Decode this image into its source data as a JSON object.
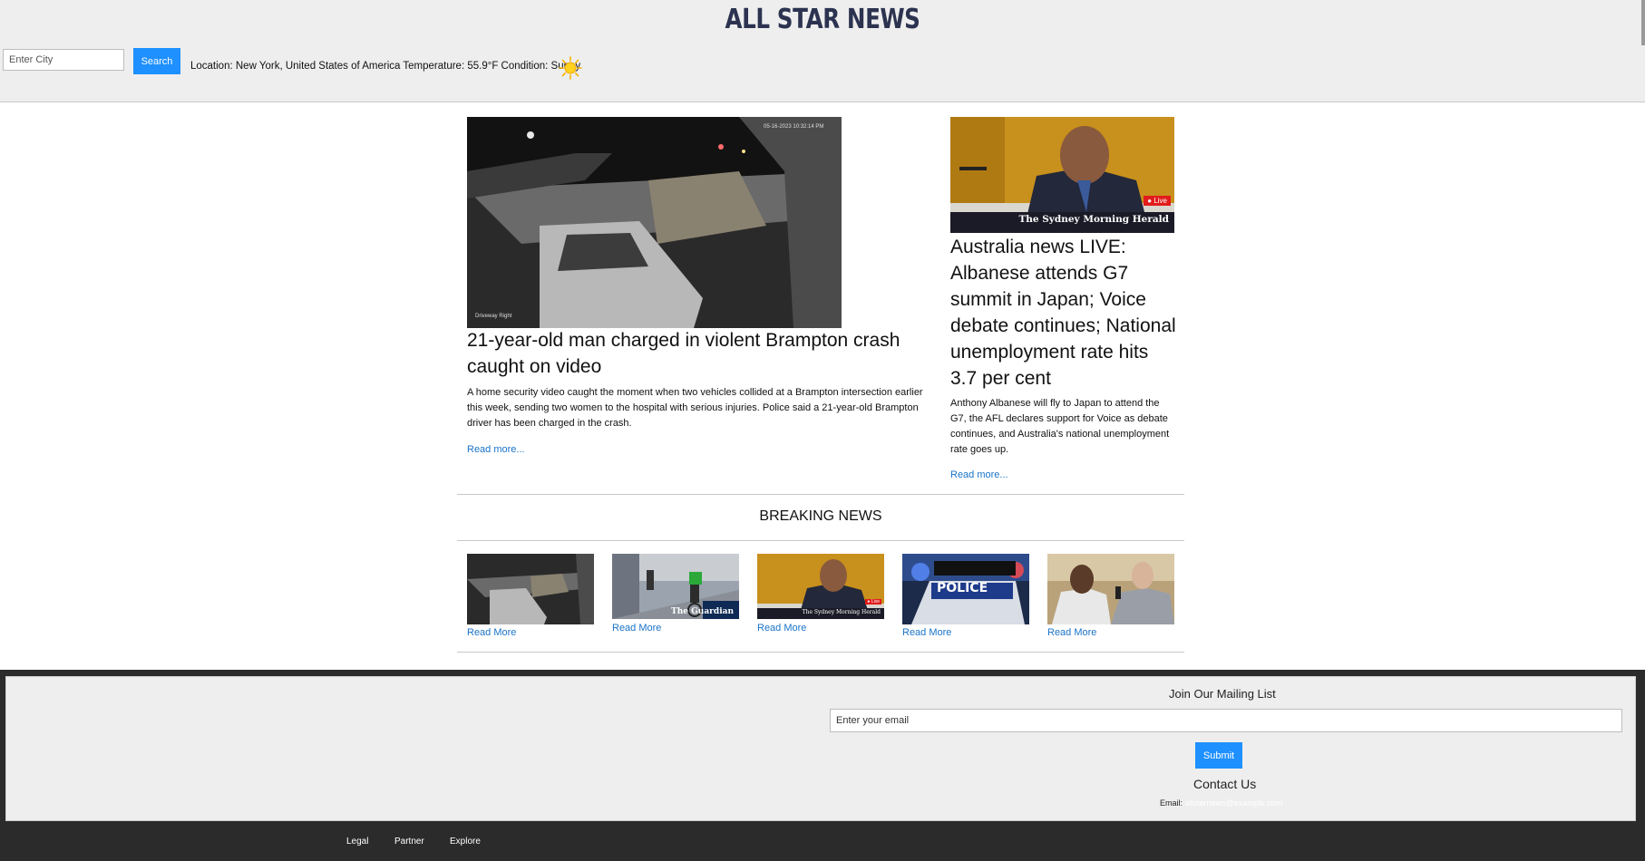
{
  "header": {
    "title": "ALL STAR NEWS",
    "city_placeholder": "Enter City",
    "search_label": "Search",
    "weather_text": "Location: New York, United States of America Temperature: 55.9°F Condition: Sunny",
    "weather_icon": "sun-icon"
  },
  "main_article": {
    "image_caption_top": "05-16-2023 10:32:14 PM",
    "image_caption_bottom": "Driveway Right",
    "title": "21-year-old man charged in violent Brampton crash caught on video",
    "summary": "A home security video caught the moment when two vehicles collided at a Brampton intersection earlier this week, sending two women to the hospital with serious injuries. Police said a 21-year-old Brampton driver has been charged in the crash.",
    "read_more": "Read more..."
  },
  "side_article": {
    "image_badge": "● Live",
    "image_logo": "The Sydney Morning Herald",
    "title": "Australia news LIVE: Albanese attends G7 summit in Japan; Voice debate continues; National unemployment rate hits 3.7 per cent",
    "summary": "Anthony Albanese will fly to Japan to attend the G7, the AFL declares support for Voice as debate continues, and Australia's national unemployment rate goes up.",
    "read_more": "Read more..."
  },
  "breaking": {
    "title": "BREAKING NEWS",
    "items": [
      {
        "link": "Read More"
      },
      {
        "link": "Read More",
        "logo": "The Guardian"
      },
      {
        "link": "Read More",
        "logo": "The Sydney Morning Herald"
      },
      {
        "link": "Read More",
        "sign": "POLICE"
      },
      {
        "link": "Read More"
      }
    ]
  },
  "footer": {
    "mailing_title": "Join Our Mailing List",
    "email_placeholder": "Enter your email",
    "submit_label": "Submit",
    "contact_title": "Contact Us",
    "contact_label": "Email:",
    "contact_email": "allstarnews@example.com",
    "links": [
      "Legal",
      "Partner",
      "Explore"
    ]
  },
  "colors": {
    "accent": "#1e90ff",
    "link": "#1a73c8",
    "title": "#2c3350",
    "footer_dark": "#2b2b2b"
  }
}
